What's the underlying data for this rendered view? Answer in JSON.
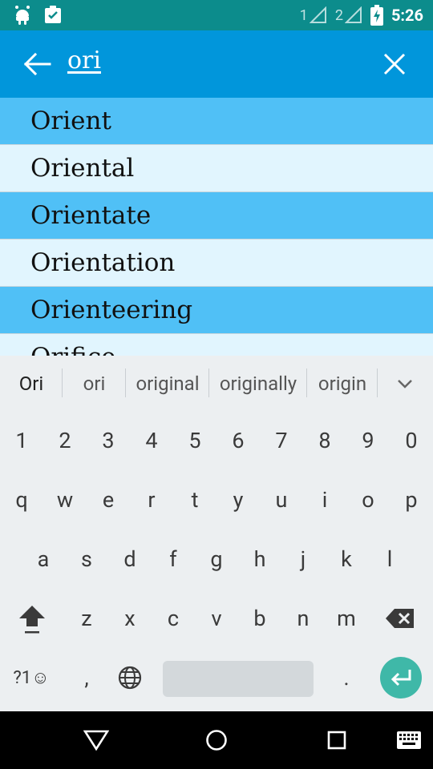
{
  "status": {
    "sim1": "1",
    "sim2": "2",
    "time": "5:26"
  },
  "search": {
    "query": "ori"
  },
  "results": [
    "Orient",
    "Oriental",
    "Orientate",
    "Orientation",
    "Orienteering",
    "Orifice"
  ],
  "suggestions": [
    "Ori",
    "ori",
    "original",
    "originally",
    "origin"
  ],
  "keyboard": {
    "numbers": [
      "1",
      "2",
      "3",
      "4",
      "5",
      "6",
      "7",
      "8",
      "9",
      "0"
    ],
    "row1": [
      "q",
      "w",
      "e",
      "r",
      "t",
      "y",
      "u",
      "i",
      "o",
      "p"
    ],
    "row2": [
      "a",
      "s",
      "d",
      "f",
      "g",
      "h",
      "j",
      "k",
      "l"
    ],
    "row3": [
      "z",
      "x",
      "c",
      "v",
      "b",
      "n",
      "m"
    ],
    "symbols_label": "?1☺",
    "comma": ",",
    "period": "."
  },
  "colors": {
    "status_bar": "#0C8C8C",
    "app_bar": "#0196DB",
    "row_dark": "#50C0F6",
    "row_light": "#E1F5FE",
    "enter_key": "#3FB8A8"
  },
  "icons": {
    "status_left": [
      "android-icon",
      "clipboard-check-icon"
    ],
    "app_bar": [
      "back-arrow-icon",
      "close-icon"
    ],
    "nav": [
      "back-nav-icon",
      "home-nav-icon",
      "recents-nav-icon",
      "keyboard-switch-icon"
    ]
  }
}
